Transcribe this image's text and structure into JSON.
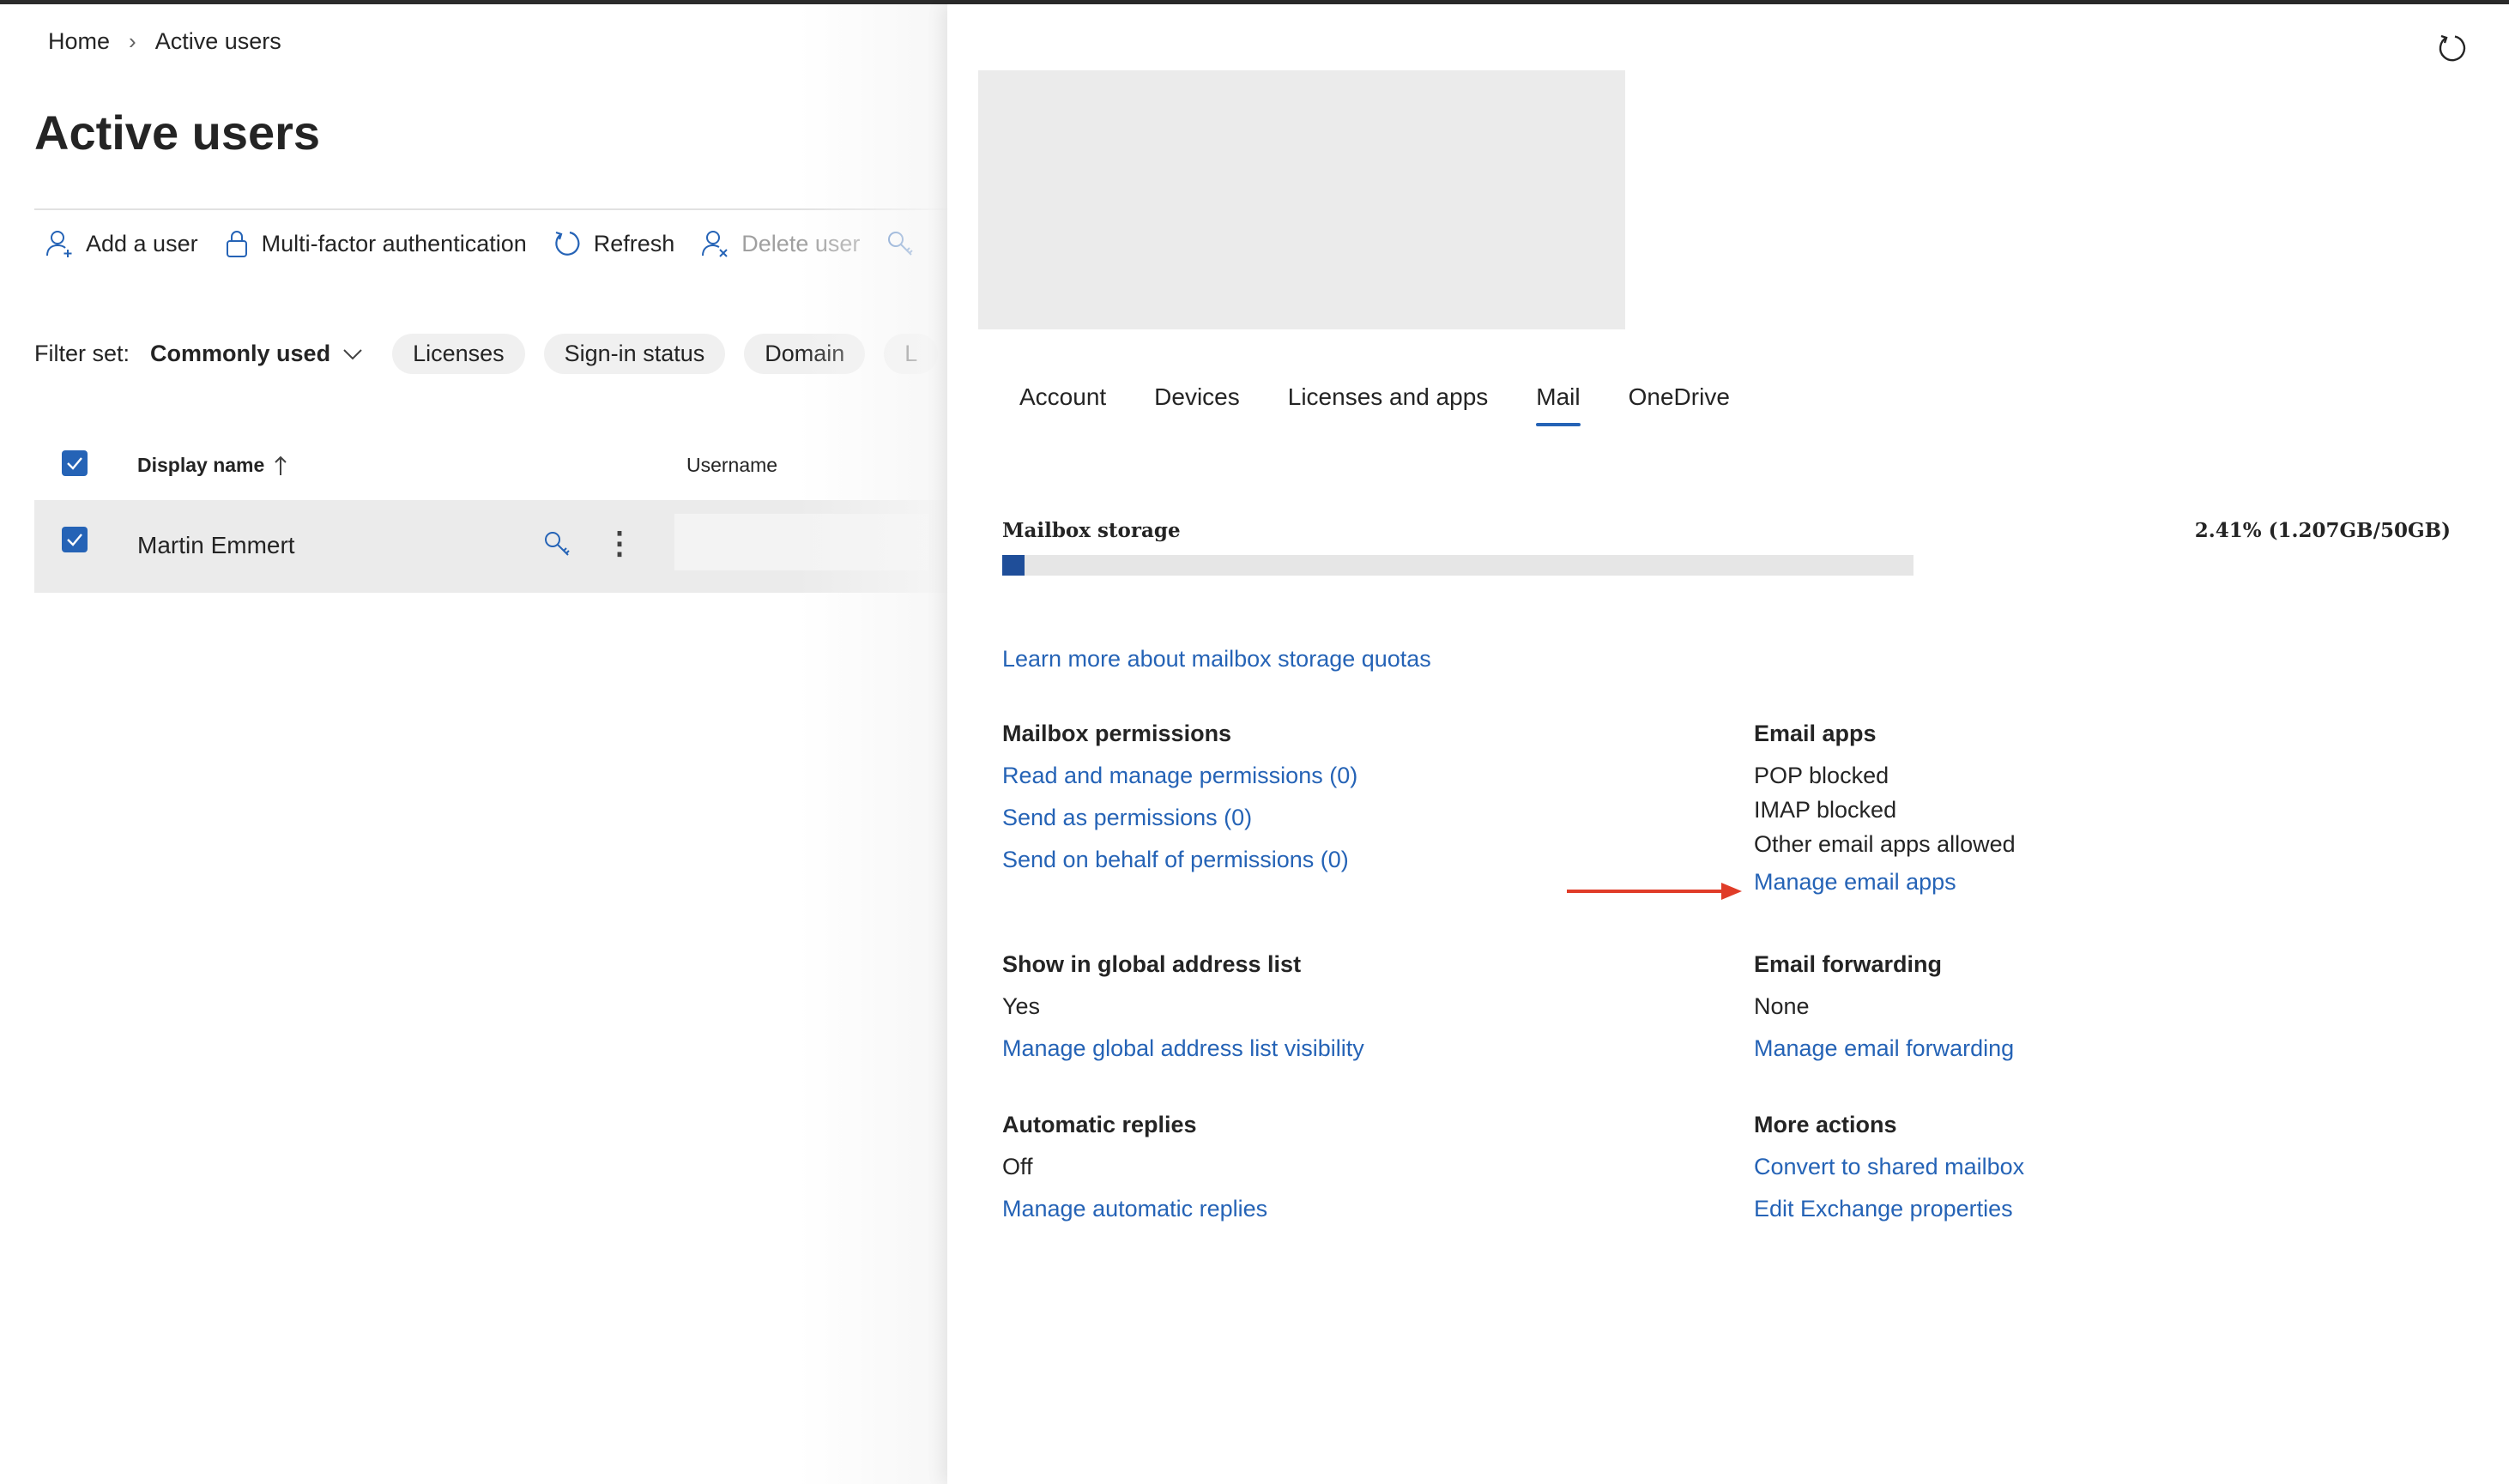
{
  "breadcrumb": {
    "home": "Home",
    "current": "Active users"
  },
  "page": {
    "title": "Active users"
  },
  "toolbar": {
    "add_user": "Add a user",
    "mfa": "Multi-factor authentication",
    "refresh": "Refresh",
    "delete_user": "Delete user"
  },
  "filter": {
    "label": "Filter set:",
    "value": "Commonly used",
    "pills": [
      "Licenses",
      "Sign-in status",
      "Domain",
      "L"
    ]
  },
  "table": {
    "headers": {
      "display_name": "Display name",
      "username": "Username"
    },
    "rows": [
      {
        "display_name": "Martin Emmert",
        "username": ""
      }
    ]
  },
  "panel": {
    "tabs": [
      "Account",
      "Devices",
      "Licenses and apps",
      "Mail",
      "OneDrive"
    ],
    "active_tab": "Mail",
    "mailbox_storage": {
      "label": "Mailbox storage",
      "value_text": "2.41% (1.207GB/50GB)",
      "percent": 2.41
    },
    "learn_more": "Learn more about mailbox storage quotas",
    "mailbox_permissions": {
      "title": "Mailbox permissions",
      "links": [
        "Read and manage permissions (0)",
        "Send as permissions (0)",
        "Send on behalf of permissions (0)"
      ]
    },
    "email_apps": {
      "title": "Email apps",
      "values": [
        "POP blocked",
        "IMAP blocked",
        "Other email apps allowed"
      ],
      "link": "Manage email apps"
    },
    "global_address": {
      "title": "Show in global address list",
      "value": "Yes",
      "link": "Manage global address list visibility"
    },
    "email_forwarding": {
      "title": "Email forwarding",
      "value": "None",
      "link": "Manage email forwarding"
    },
    "automatic_replies": {
      "title": "Automatic replies",
      "value": "Off",
      "link": "Manage automatic replies"
    },
    "more_actions": {
      "title": "More actions",
      "links": [
        "Convert to shared mailbox",
        "Edit Exchange properties"
      ]
    }
  },
  "colors": {
    "accent": "#2563b6",
    "storage_fill": "#1f4e99",
    "annotation_arrow": "#e03c28"
  }
}
